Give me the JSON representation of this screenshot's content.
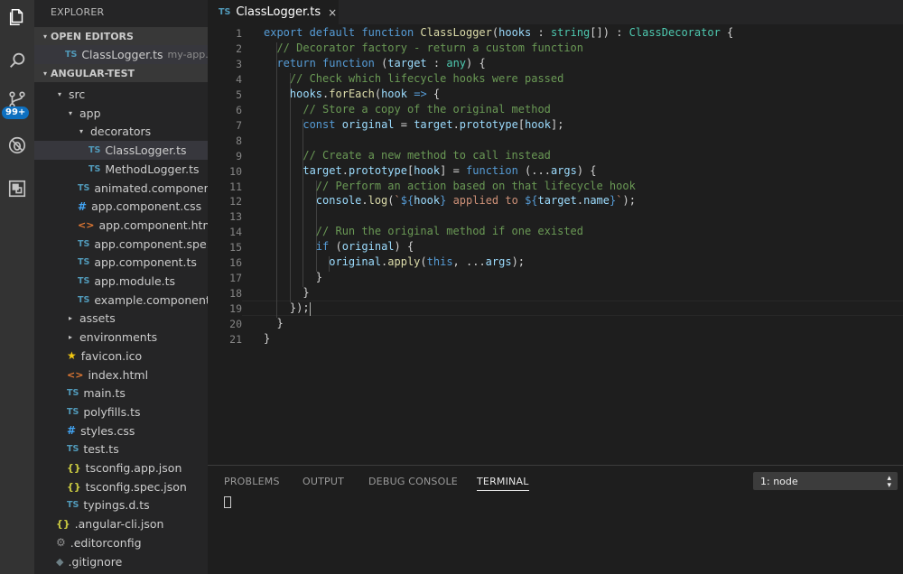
{
  "activity_bar": {
    "icons": [
      "files-icon",
      "search-icon",
      "source-control-icon",
      "debug-icon",
      "extensions-icon"
    ],
    "scm_badge": "99+"
  },
  "explorer": {
    "title": "EXPLORER",
    "open_editors_header": "OPEN EDITORS",
    "open_editor": {
      "icon": "TS",
      "name": "ClassLogger.ts",
      "path": "my-app..."
    },
    "project_header": "ANGULAR-TEST",
    "tree": [
      {
        "label": "src",
        "kind": "folder-open",
        "depth": 1
      },
      {
        "label": "app",
        "kind": "folder-open",
        "depth": 2
      },
      {
        "label": "decorators",
        "kind": "folder-open",
        "depth": 3
      },
      {
        "label": "ClassLogger.ts",
        "kind": "ts",
        "icon": "TS",
        "depth": 4,
        "selected": true
      },
      {
        "label": "MethodLogger.ts",
        "kind": "ts",
        "icon": "TS",
        "depth": 4
      },
      {
        "label": "animated.componen...",
        "kind": "ts",
        "icon": "TS",
        "depth": 3
      },
      {
        "label": "app.component.css",
        "kind": "css",
        "icon": "#",
        "depth": 3
      },
      {
        "label": "app.component.html",
        "kind": "html",
        "icon": "<>",
        "depth": 3
      },
      {
        "label": "app.component.spe...",
        "kind": "ts",
        "icon": "TS",
        "depth": 3
      },
      {
        "label": "app.component.ts",
        "kind": "ts",
        "icon": "TS",
        "depth": 3
      },
      {
        "label": "app.module.ts",
        "kind": "ts",
        "icon": "TS",
        "depth": 3
      },
      {
        "label": "example.component...",
        "kind": "ts",
        "icon": "TS",
        "depth": 3
      },
      {
        "label": "assets",
        "kind": "folder-closed",
        "depth": 2
      },
      {
        "label": "environments",
        "kind": "folder-closed",
        "depth": 2
      },
      {
        "label": "favicon.ico",
        "kind": "star",
        "icon": "★",
        "depth": 2
      },
      {
        "label": "index.html",
        "kind": "html",
        "icon": "<>",
        "depth": 2
      },
      {
        "label": "main.ts",
        "kind": "ts",
        "icon": "TS",
        "depth": 2
      },
      {
        "label": "polyfills.ts",
        "kind": "ts",
        "icon": "TS",
        "depth": 2
      },
      {
        "label": "styles.css",
        "kind": "css",
        "icon": "#",
        "depth": 2
      },
      {
        "label": "test.ts",
        "kind": "ts",
        "icon": "TS",
        "depth": 2
      },
      {
        "label": "tsconfig.app.json",
        "kind": "json",
        "icon": "{}",
        "depth": 2
      },
      {
        "label": "tsconfig.spec.json",
        "kind": "json",
        "icon": "{}",
        "depth": 2
      },
      {
        "label": "typings.d.ts",
        "kind": "ts",
        "icon": "TS",
        "depth": 2
      },
      {
        "label": ".angular-cli.json",
        "kind": "json",
        "icon": "{}",
        "depth": 1
      },
      {
        "label": ".editorconfig",
        "kind": "gear",
        "icon": "⚙",
        "depth": 1
      },
      {
        "label": ".gitignore",
        "kind": "git",
        "icon": "◆",
        "depth": 1
      }
    ]
  },
  "tab": {
    "icon": "TS",
    "title": "ClassLogger.ts",
    "close": "×"
  },
  "editor": {
    "lines": [
      [
        [
          "kw",
          "export "
        ],
        [
          "kw",
          "default "
        ],
        [
          "kw",
          "function "
        ],
        [
          "fn",
          "ClassLogger"
        ],
        [
          "p",
          "("
        ],
        [
          "vr",
          "hooks"
        ],
        [
          "p",
          " : "
        ],
        [
          "ty",
          "string"
        ],
        [
          "p",
          "[]) : "
        ],
        [
          "ty",
          "ClassDecorator"
        ],
        [
          "p",
          " {"
        ]
      ],
      [
        [
          "p",
          "  "
        ],
        [
          "cm",
          "// Decorator factory - return a custom function"
        ]
      ],
      [
        [
          "p",
          "  "
        ],
        [
          "kw",
          "return "
        ],
        [
          "kw",
          "function "
        ],
        [
          "p",
          "("
        ],
        [
          "vr",
          "target"
        ],
        [
          "p",
          " : "
        ],
        [
          "ty",
          "any"
        ],
        [
          "p",
          ") {"
        ]
      ],
      [
        [
          "p",
          "    "
        ],
        [
          "cm",
          "// Check which lifecycle hooks were passed"
        ]
      ],
      [
        [
          "p",
          "    "
        ],
        [
          "vr",
          "hooks"
        ],
        [
          "p",
          "."
        ],
        [
          "fn",
          "forEach"
        ],
        [
          "p",
          "("
        ],
        [
          "vr",
          "hook"
        ],
        [
          "p",
          " "
        ],
        [
          "kw",
          "=>"
        ],
        [
          "p",
          " {"
        ]
      ],
      [
        [
          "p",
          "      "
        ],
        [
          "cm",
          "// Store a copy of the original method"
        ]
      ],
      [
        [
          "p",
          "      "
        ],
        [
          "kw",
          "const "
        ],
        [
          "vr",
          "original"
        ],
        [
          "p",
          " = "
        ],
        [
          "vr",
          "target"
        ],
        [
          "p",
          "."
        ],
        [
          "vr",
          "prototype"
        ],
        [
          "p",
          "["
        ],
        [
          "vr",
          "hook"
        ],
        [
          "p",
          "];"
        ]
      ],
      [],
      [
        [
          "p",
          "      "
        ],
        [
          "cm",
          "// Create a new method to call instead"
        ]
      ],
      [
        [
          "p",
          "      "
        ],
        [
          "vr",
          "target"
        ],
        [
          "p",
          "."
        ],
        [
          "vr",
          "prototype"
        ],
        [
          "p",
          "["
        ],
        [
          "vr",
          "hook"
        ],
        [
          "p",
          "] = "
        ],
        [
          "kw",
          "function"
        ],
        [
          "p",
          " (..."
        ],
        [
          "vr",
          "args"
        ],
        [
          "p",
          ") {"
        ]
      ],
      [
        [
          "p",
          "        "
        ],
        [
          "cm",
          "// Perform an action based on that lifecycle hook"
        ]
      ],
      [
        [
          "p",
          "        "
        ],
        [
          "vr",
          "console"
        ],
        [
          "p",
          "."
        ],
        [
          "fn",
          "log"
        ],
        [
          "p",
          "("
        ],
        [
          "st",
          "`"
        ],
        [
          "kw",
          "${"
        ],
        [
          "vr",
          "hook"
        ],
        [
          "kw",
          "}"
        ],
        [
          "st",
          " applied to "
        ],
        [
          "kw",
          "${"
        ],
        [
          "vr",
          "target"
        ],
        [
          "p",
          "."
        ],
        [
          "vr",
          "name"
        ],
        [
          "kw",
          "}"
        ],
        [
          "st",
          "`"
        ],
        [
          "p",
          ");"
        ]
      ],
      [],
      [
        [
          "p",
          "        "
        ],
        [
          "cm",
          "// Run the original method if one existed"
        ]
      ],
      [
        [
          "p",
          "        "
        ],
        [
          "kw",
          "if "
        ],
        [
          "p",
          "("
        ],
        [
          "vr",
          "original"
        ],
        [
          "p",
          ") {"
        ]
      ],
      [
        [
          "p",
          "          "
        ],
        [
          "vr",
          "original"
        ],
        [
          "p",
          "."
        ],
        [
          "fn",
          "apply"
        ],
        [
          "p",
          "("
        ],
        [
          "kw",
          "this"
        ],
        [
          "p",
          ", ..."
        ],
        [
          "vr",
          "args"
        ],
        [
          "p",
          ");"
        ]
      ],
      [
        [
          "p",
          "        }"
        ]
      ],
      [
        [
          "p",
          "      }"
        ]
      ],
      [
        [
          "p",
          "    });"
        ]
      ],
      [
        [
          "p",
          "  }"
        ]
      ],
      [
        [
          "p",
          "}"
        ]
      ]
    ],
    "line_numbers": [
      "1",
      "2",
      "3",
      "4",
      "5",
      "6",
      "7",
      "8",
      "9",
      "10",
      "11",
      "12",
      "13",
      "14",
      "15",
      "16",
      "17",
      "18",
      "19",
      "20",
      "21"
    ]
  },
  "panel": {
    "tabs": [
      "PROBLEMS",
      "OUTPUT",
      "DEBUG CONSOLE",
      "TERMINAL"
    ],
    "active_tab": "TERMINAL",
    "terminal_select": "1: node"
  },
  "colors": {
    "keyword": "#569cd6",
    "comment": "#6a9955",
    "type": "#4ec9b0",
    "function": "#dcdcaa",
    "variable": "#9cdcfe",
    "string": "#ce9178",
    "activity_bar": "#333333",
    "sidebar": "#252526",
    "editor": "#1e1e1e",
    "badge": "#0e70c0"
  }
}
